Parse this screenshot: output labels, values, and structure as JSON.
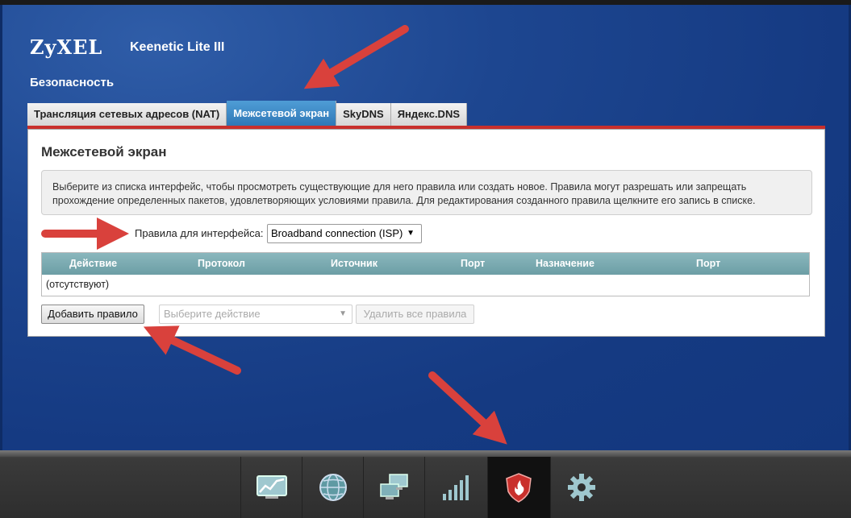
{
  "header": {
    "logo": "ZyXEL",
    "model": "Keenetic Lite III",
    "section_title": "Безопасность"
  },
  "tabs": [
    {
      "label": "Трансляция сетевых адресов (NAT)",
      "active": false
    },
    {
      "label": "Межсетевой экран",
      "active": true
    },
    {
      "label": "SkyDNS",
      "active": false
    },
    {
      "label": "Яндекс.DNS",
      "active": false
    }
  ],
  "panel": {
    "title": "Межсетевой экран",
    "info": "Выберите из списка интерфейс, чтобы просмотреть существующие для него правила или создать новое. Правила могут разрешать или запрещать прохождение определенных пакетов, удовлетворяющих условиями правила. Для редактирования созданного правила щелкните его запись в списке.",
    "interface_label": "Правила для интерфейса:",
    "interface_value": "Broadband connection (ISP)",
    "table": {
      "columns": [
        "Действие",
        "Протокол",
        "Источник",
        "Порт",
        "Назначение",
        "Порт"
      ],
      "empty_text": "(отсутствуют)"
    },
    "add_rule_label": "Добавить правило",
    "action_placeholder": "Выберите действие",
    "delete_all_label": "Удалить все правила"
  },
  "bottom_nav": [
    {
      "icon": "monitor-chart-icon",
      "active": false
    },
    {
      "icon": "globe-icon",
      "active": false
    },
    {
      "icon": "network-computers-icon",
      "active": false
    },
    {
      "icon": "wifi-signal-icon",
      "active": false
    },
    {
      "icon": "shield-firewall-icon",
      "active": true
    },
    {
      "icon": "gear-icon",
      "active": false
    }
  ],
  "colors": {
    "background_blue": "#153a82",
    "active_tab": "#2f78b6",
    "tab_underline": "#c9302c",
    "table_header": "#7aa9b0",
    "annotation_arrow": "#d9413c"
  }
}
